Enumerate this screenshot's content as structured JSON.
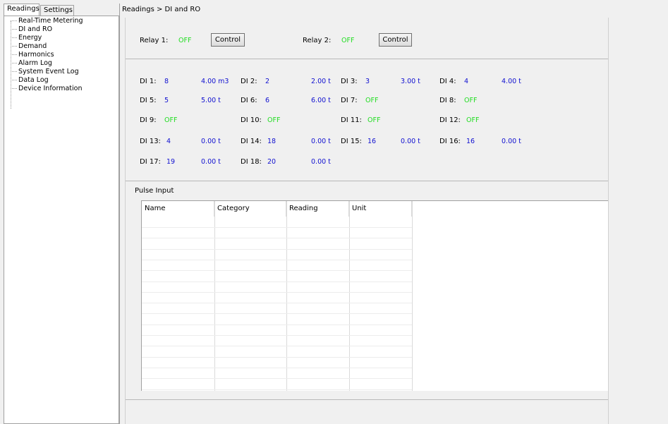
{
  "tabs": {
    "readings": "Readings",
    "settings": "Settings"
  },
  "tree": [
    "Real-Time Metering",
    "DI and RO",
    "Energy",
    "Demand",
    "Harmonics",
    "Alarm Log",
    "System Event Log",
    "Data Log",
    "Device Information"
  ],
  "breadcrumb": "Readings > DI and RO",
  "relays": [
    {
      "label": "Relay 1:",
      "state": "OFF",
      "button": "Control"
    },
    {
      "label": "Relay 2:",
      "state": "OFF",
      "button": "Control"
    }
  ],
  "di_rows": [
    [
      {
        "label": "DI 1:",
        "val": "8",
        "unit": "4.00 m3"
      },
      {
        "label": "DI 2:",
        "val": "2",
        "unit": "2.00 t"
      },
      {
        "label": "DI 3:",
        "val": "3",
        "unit": "3.00 t"
      },
      {
        "label": "DI 4:",
        "val": "4",
        "unit": "4.00 t"
      }
    ],
    [
      {
        "label": "DI 5:",
        "val": "5",
        "unit": "5.00 t"
      },
      {
        "label": "DI 6:",
        "val": "6",
        "unit": "6.00 t"
      },
      {
        "label": "DI 7:",
        "val": "OFF",
        "unit": ""
      },
      {
        "label": "DI 8:",
        "val": "OFF",
        "unit": ""
      }
    ],
    [
      {
        "label": "DI 9:",
        "val": "OFF",
        "unit": ""
      },
      {
        "label": "DI 10:",
        "val": "OFF",
        "unit": ""
      },
      {
        "label": "DI 11:",
        "val": "OFF",
        "unit": ""
      },
      {
        "label": "DI 12:",
        "val": "OFF",
        "unit": ""
      }
    ],
    [
      {
        "label": "DI 13:",
        "val": "4",
        "unit": "0.00 t"
      },
      {
        "label": "DI 14:",
        "val": "18",
        "unit": "0.00 t"
      },
      {
        "label": "DI 15:",
        "val": "16",
        "unit": "0.00 t"
      },
      {
        "label": "DI 16:",
        "val": "16",
        "unit": "0.00 t"
      }
    ],
    [
      {
        "label": "DI 17:",
        "val": "19",
        "unit": "0.00 t"
      },
      {
        "label": "DI 18:",
        "val": "20",
        "unit": "0.00 t"
      }
    ]
  ],
  "pulse_input": {
    "title": "Pulse Input",
    "columns": [
      "Name",
      "Category",
      "Reading",
      "Unit"
    ]
  },
  "colors": {
    "off": "#22dd22",
    "value": "#1010d0"
  }
}
